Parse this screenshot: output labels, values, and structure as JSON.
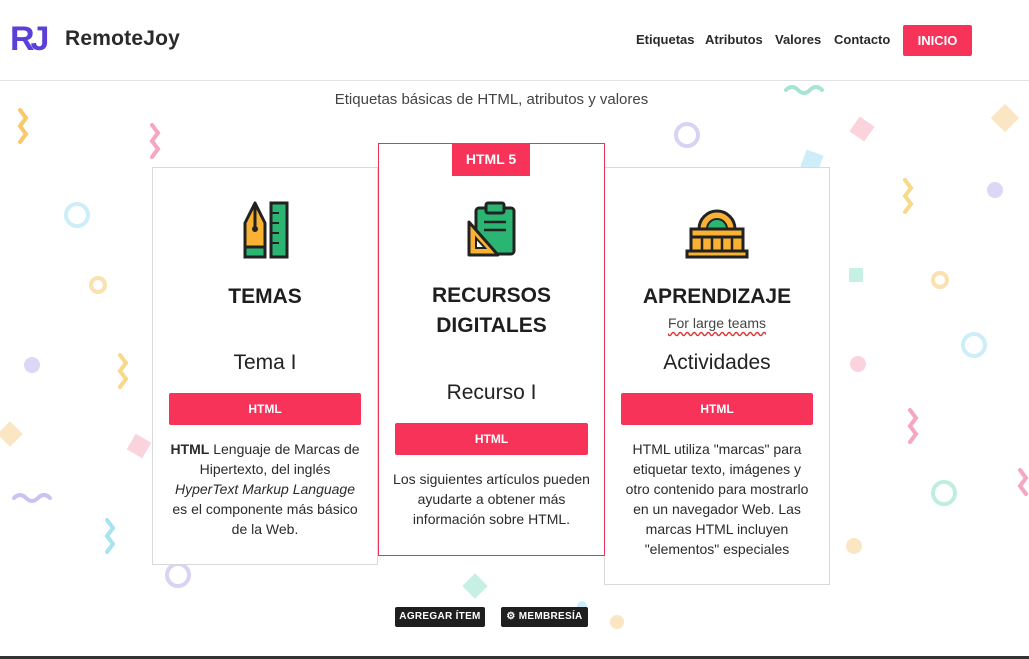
{
  "header": {
    "logo_text": "RJ",
    "brand": "RemoteJoy",
    "nav": [
      "Etiquetas",
      "Atributos",
      "Valores",
      "Contacto"
    ],
    "cta": "INICIO"
  },
  "subtitle": "Etiquetas básicas de HTML, atributos y valores",
  "cards": [
    {
      "icon": "pen-ruler-icon",
      "title": "TEMAS",
      "item": "Tema I",
      "button": "HTML",
      "text_bold": "HTML",
      "text_1": " Lenguaje de Marcas de Hipertexto, del inglés ",
      "text_italic": "HyperText Markup Language",
      "text_2": " es el componente más básico de la Web."
    },
    {
      "ribbon": "HTML 5",
      "icon": "clipboard-ruler-icon",
      "title_line1": "RECURSOS",
      "title_line2": "DIGITALES",
      "item": "Recurso I",
      "button": "HTML",
      "text": "Los siguientes artículos pueden ayudarte a obtener más información sobre HTML."
    },
    {
      "icon": "building-icon",
      "title": "APRENDIZAJE",
      "subtitle": "For large teams",
      "item": "Actividades",
      "button": "HTML",
      "text": "HTML utiliza \"marcas\" para etiquetar texto, imágenes y otro contenido para mostrarlo en un navegador Web. Las marcas HTML incluyen \"elementos\" especiales"
    }
  ],
  "actions": {
    "add_item": "AGREGAR ÍTEM",
    "membership_icon": "gear-icon",
    "membership": "MEMBRESÍA"
  },
  "colors": {
    "accent": "#f7335a",
    "logo": "#5b3fd6",
    "dark_button": "#1f1f1f"
  }
}
